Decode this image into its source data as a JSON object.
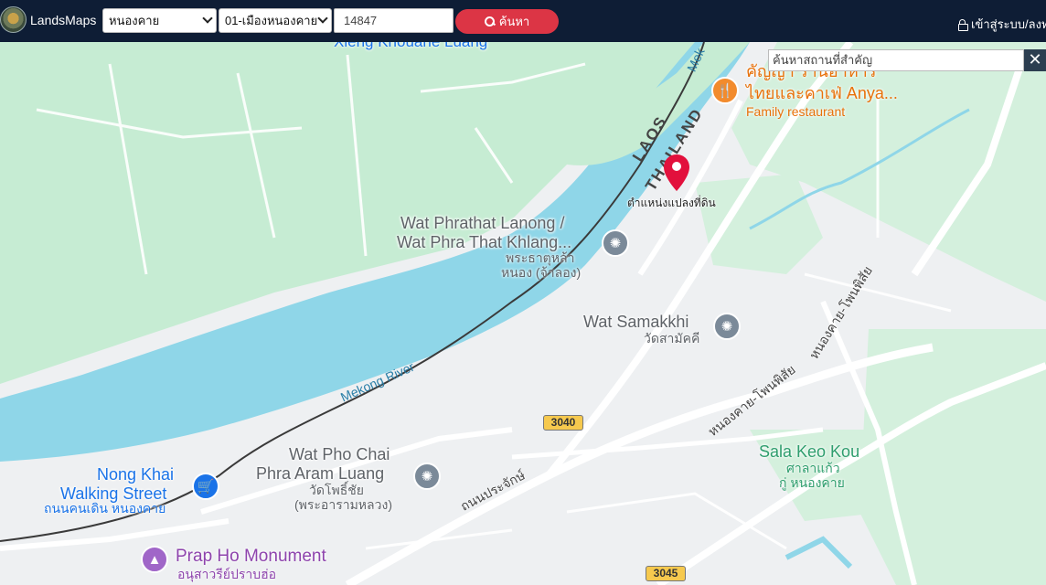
{
  "app": {
    "brand": "LandsMaps"
  },
  "search": {
    "province": "หนองคาย",
    "district": "01-เมืองหนองคาย",
    "parcel_no": "14847",
    "button_label": "ค้นหา"
  },
  "user": {
    "login_label": "เข้าสู่ระบบ/ลงท"
  },
  "place_search": {
    "placeholder": "ค้นหาสถานที่สำคัญ",
    "close_label": "✕"
  },
  "marker": {
    "label": "ตำแหน่งแปลงที่ดิน"
  },
  "map_labels": {
    "top_partial": "Xieng Khouane Luang",
    "restaurant_name": "คัญญา ร้านอาหาร",
    "restaurant_name2": "ไทยและคาเฟ่ Anya...",
    "restaurant_type": "Family restaurant",
    "border_laos": "LAOS",
    "border_thailand": "THAILAND",
    "wat_lanong": "Wat Phrathat Lanong /",
    "wat_lanong2": "Wat Phra That Khlang...",
    "wat_lanong_th": "พระธาตุหล้า",
    "wat_lanong_th2": "หนอง (จ้าลอง)",
    "wat_samakkhi": "Wat Samakkhi",
    "wat_samakkhi_th": "วัดสามัคคี",
    "mekong_river": "Mekong River",
    "mekong_top": "Mek",
    "road_nongkhai_phonphisai": "หนองคาย-โพนพิสัย",
    "road_nongkhai_phonphisai2": "หนองคาย-โพนพิสัย",
    "road_prachak": "ถนนประจักษ์",
    "route_3040": "3040",
    "route_3045": "3045",
    "wat_pho_chai": "Wat Pho Chai",
    "wat_pho_chai2": "Phra Aram Luang",
    "wat_pho_chai_th": "วัดโพธิ์ชัย",
    "wat_pho_chai_th2": "(พระอารามหลวง)",
    "walking_street": "Nong Khai",
    "walking_street2": "Walking Street",
    "walking_street_th": "ถนนคนเดิน หนองคาย",
    "sala_keo_kou": "Sala Keo Kou",
    "sala_keo_kou_th": "ศาลาแก้ว",
    "sala_keo_kou_th2": "กู่ หนองคาย",
    "prap_ho": "Prap Ho Monument",
    "prap_ho_th": "อนุสาวรีย์ปราบฮ่อ"
  },
  "colors": {
    "nav_bg": "#0e1d35",
    "search_button": "#dc3545",
    "river": "#8fd6e8",
    "green_area": "#c6ecd3",
    "marker": "#e2103c"
  }
}
